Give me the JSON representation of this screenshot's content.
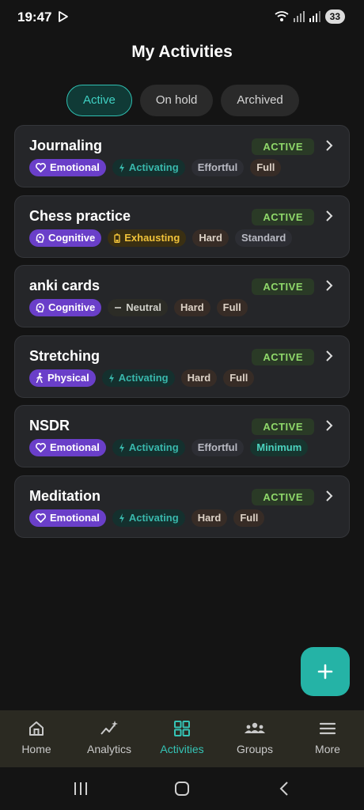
{
  "status_bar": {
    "time": "19:47",
    "battery": "33"
  },
  "page": {
    "title": "My Activities"
  },
  "tabs": [
    {
      "label": "Active",
      "active": true
    },
    {
      "label": "On hold",
      "active": false
    },
    {
      "label": "Archived",
      "active": false
    }
  ],
  "activities": [
    {
      "name": "Journaling",
      "status": "ACTIVE",
      "tags": [
        "Emotional",
        "Activating",
        "Effortful",
        "Full"
      ]
    },
    {
      "name": "Chess practice",
      "status": "ACTIVE",
      "tags": [
        "Cognitive",
        "Exhausting",
        "Hard",
        "Standard"
      ]
    },
    {
      "name": "anki cards",
      "status": "ACTIVE",
      "tags": [
        "Cognitive",
        "Neutral",
        "Hard",
        "Full"
      ]
    },
    {
      "name": "Stretching",
      "status": "ACTIVE",
      "tags": [
        "Physical",
        "Activating",
        "Hard",
        "Full"
      ]
    },
    {
      "name": "NSDR",
      "status": "ACTIVE",
      "tags": [
        "Emotional",
        "Activating",
        "Effortful",
        "Minimum"
      ]
    },
    {
      "name": "Meditation",
      "status": "ACTIVE",
      "tags": [
        "Emotional",
        "Activating",
        "Hard",
        "Full"
      ]
    }
  ],
  "fab": {
    "icon": "plus-icon"
  },
  "bottom_nav": [
    {
      "label": "Home",
      "icon": "home-icon",
      "active": false
    },
    {
      "label": "Analytics",
      "icon": "analytics-icon",
      "active": false
    },
    {
      "label": "Activities",
      "icon": "grid-icon",
      "active": true
    },
    {
      "label": "Groups",
      "icon": "groups-icon",
      "active": false
    },
    {
      "label": "More",
      "icon": "menu-icon",
      "active": false
    }
  ],
  "colors": {
    "accent": "#25b3a6",
    "background": "#141414",
    "card": "#252629",
    "active_badge": "#8fd86a"
  }
}
